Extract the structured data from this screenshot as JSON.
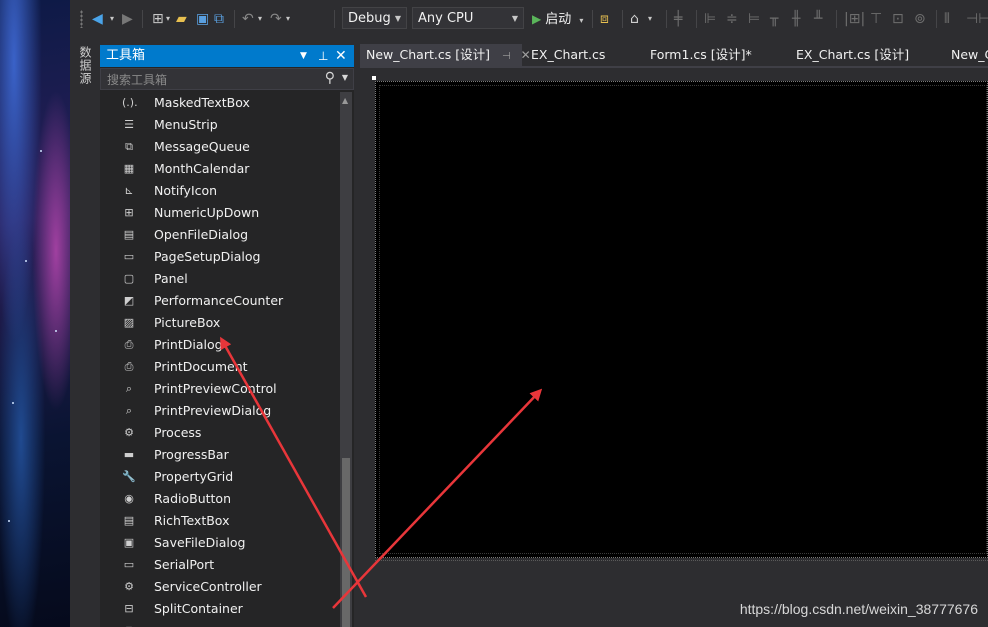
{
  "toolbar": {
    "config": "Debug",
    "platform": "Any CPU",
    "start_label": "启动"
  },
  "side_tab": {
    "label": "数据源"
  },
  "toolbox": {
    "title": "工具箱",
    "search_placeholder": "搜索工具箱",
    "items": [
      {
        "label": "MaskedTextBox",
        "icon": "(.)."
      },
      {
        "label": "MenuStrip",
        "icon": "☰"
      },
      {
        "label": "MessageQueue",
        "icon": "⧉"
      },
      {
        "label": "MonthCalendar",
        "icon": "▦"
      },
      {
        "label": "NotifyIcon",
        "icon": "⊾"
      },
      {
        "label": "NumericUpDown",
        "icon": "⊞"
      },
      {
        "label": "OpenFileDialog",
        "icon": "▤"
      },
      {
        "label": "PageSetupDialog",
        "icon": "▭"
      },
      {
        "label": "Panel",
        "icon": "▢"
      },
      {
        "label": "PerformanceCounter",
        "icon": "◩"
      },
      {
        "label": "PictureBox",
        "icon": "▨"
      },
      {
        "label": "PrintDialog",
        "icon": "⎙"
      },
      {
        "label": "PrintDocument",
        "icon": "⎙"
      },
      {
        "label": "PrintPreviewControl",
        "icon": "⌕"
      },
      {
        "label": "PrintPreviewDialog",
        "icon": "⌕"
      },
      {
        "label": "Process",
        "icon": "⚙"
      },
      {
        "label": "ProgressBar",
        "icon": "▬"
      },
      {
        "label": "PropertyGrid",
        "icon": "🔧"
      },
      {
        "label": "RadioButton",
        "icon": "◉"
      },
      {
        "label": "RichTextBox",
        "icon": "▤"
      },
      {
        "label": "SaveFileDialog",
        "icon": "▣"
      },
      {
        "label": "SerialPort",
        "icon": "▭"
      },
      {
        "label": "ServiceController",
        "icon": "⚙"
      },
      {
        "label": "SplitContainer",
        "icon": "⊟"
      },
      {
        "label": "",
        "icon": "▢"
      }
    ]
  },
  "tabs": [
    {
      "label": "New_Chart.cs [设计]",
      "active": true
    },
    {
      "label": "EX_Chart.cs"
    },
    {
      "label": "Form1.cs [设计]*"
    },
    {
      "label": "EX_Chart.cs [设计]"
    },
    {
      "label": "New_C"
    }
  ],
  "watermark": "https://blog.csdn.net/weixin_38777676",
  "colors": {
    "accent": "#007acc",
    "background": "#2d2d30",
    "panel": "#252526",
    "arrow": "#e8363a"
  }
}
